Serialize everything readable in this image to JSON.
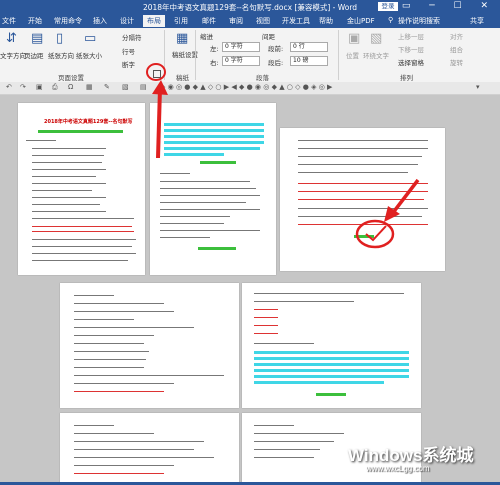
{
  "titlebar": {
    "title": "2018年中考语文真题129套--名句默写.docx [兼容模式] - Word",
    "login": "登录"
  },
  "tabs": [
    "文件",
    "开始",
    "常用命令",
    "插入",
    "设计",
    "布局",
    "引用",
    "邮件",
    "审阅",
    "视图",
    "开发工具",
    "帮助",
    "金山PDF",
    "操作说明搜索",
    "共享"
  ],
  "ribbon": {
    "text_direction": "文字方向",
    "margins": "页边距",
    "orientation": "纸张方向",
    "size": "纸张大小",
    "breaks": "分隔符",
    "line_numbers": "行号",
    "hyphenation": "断字",
    "draft_settings": "稿纸设置",
    "page_setup_group": "页面设置",
    "draft_group": "稿纸",
    "indent": "缩进",
    "spacing": "间距",
    "left_label": "左:",
    "right_label": "右:",
    "before_label": "段前:",
    "after_label": "段后:",
    "indent_left": "0 字符",
    "indent_right": "0 字符",
    "space_before": "0 行",
    "space_after": "10 磅",
    "paragraph_group": "段落",
    "position": "位置",
    "wrap_text": "环绕文字",
    "bring_forward": "上移一层",
    "send_backward": "下移一层",
    "selection_pane": "选择窗格",
    "align": "对齐",
    "group": "组合",
    "rotate": "旋转",
    "arrange_group": "排列"
  },
  "pages": {
    "page1_title": "2018年中考语文真题129套--名句默写"
  },
  "watermark": {
    "brand": "Windows系统城",
    "url": "www.wxcLgg.com"
  }
}
